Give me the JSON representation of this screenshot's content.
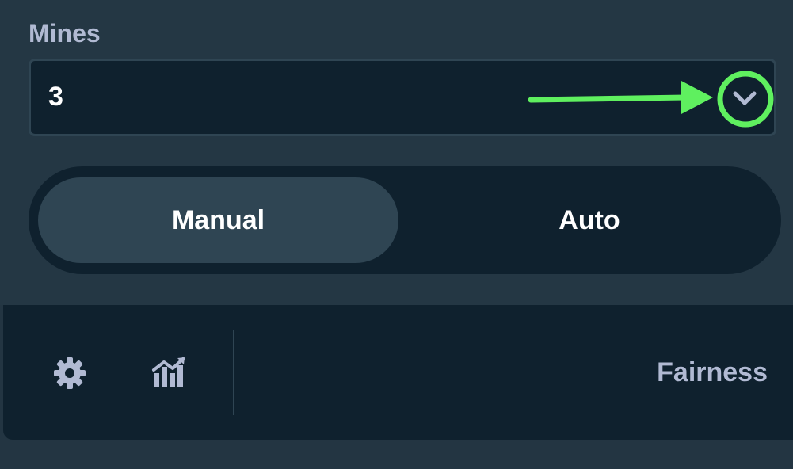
{
  "mines_label": "Mines",
  "mines_value": "3",
  "mode_toggle": {
    "manual_label": "Manual",
    "auto_label": "Auto",
    "selected": "Manual"
  },
  "footer": {
    "fairness_label": "Fairness",
    "settings_icon": "gear-icon",
    "stats_icon": "stats-icon"
  },
  "annotation": {
    "color": "#5ff05f",
    "target": "mines-dropdown-chevron"
  },
  "colors": {
    "panel_bg": "#243744",
    "input_bg": "#0f212e",
    "active_toggle": "#2f4553",
    "label_text": "#b1bad3"
  }
}
